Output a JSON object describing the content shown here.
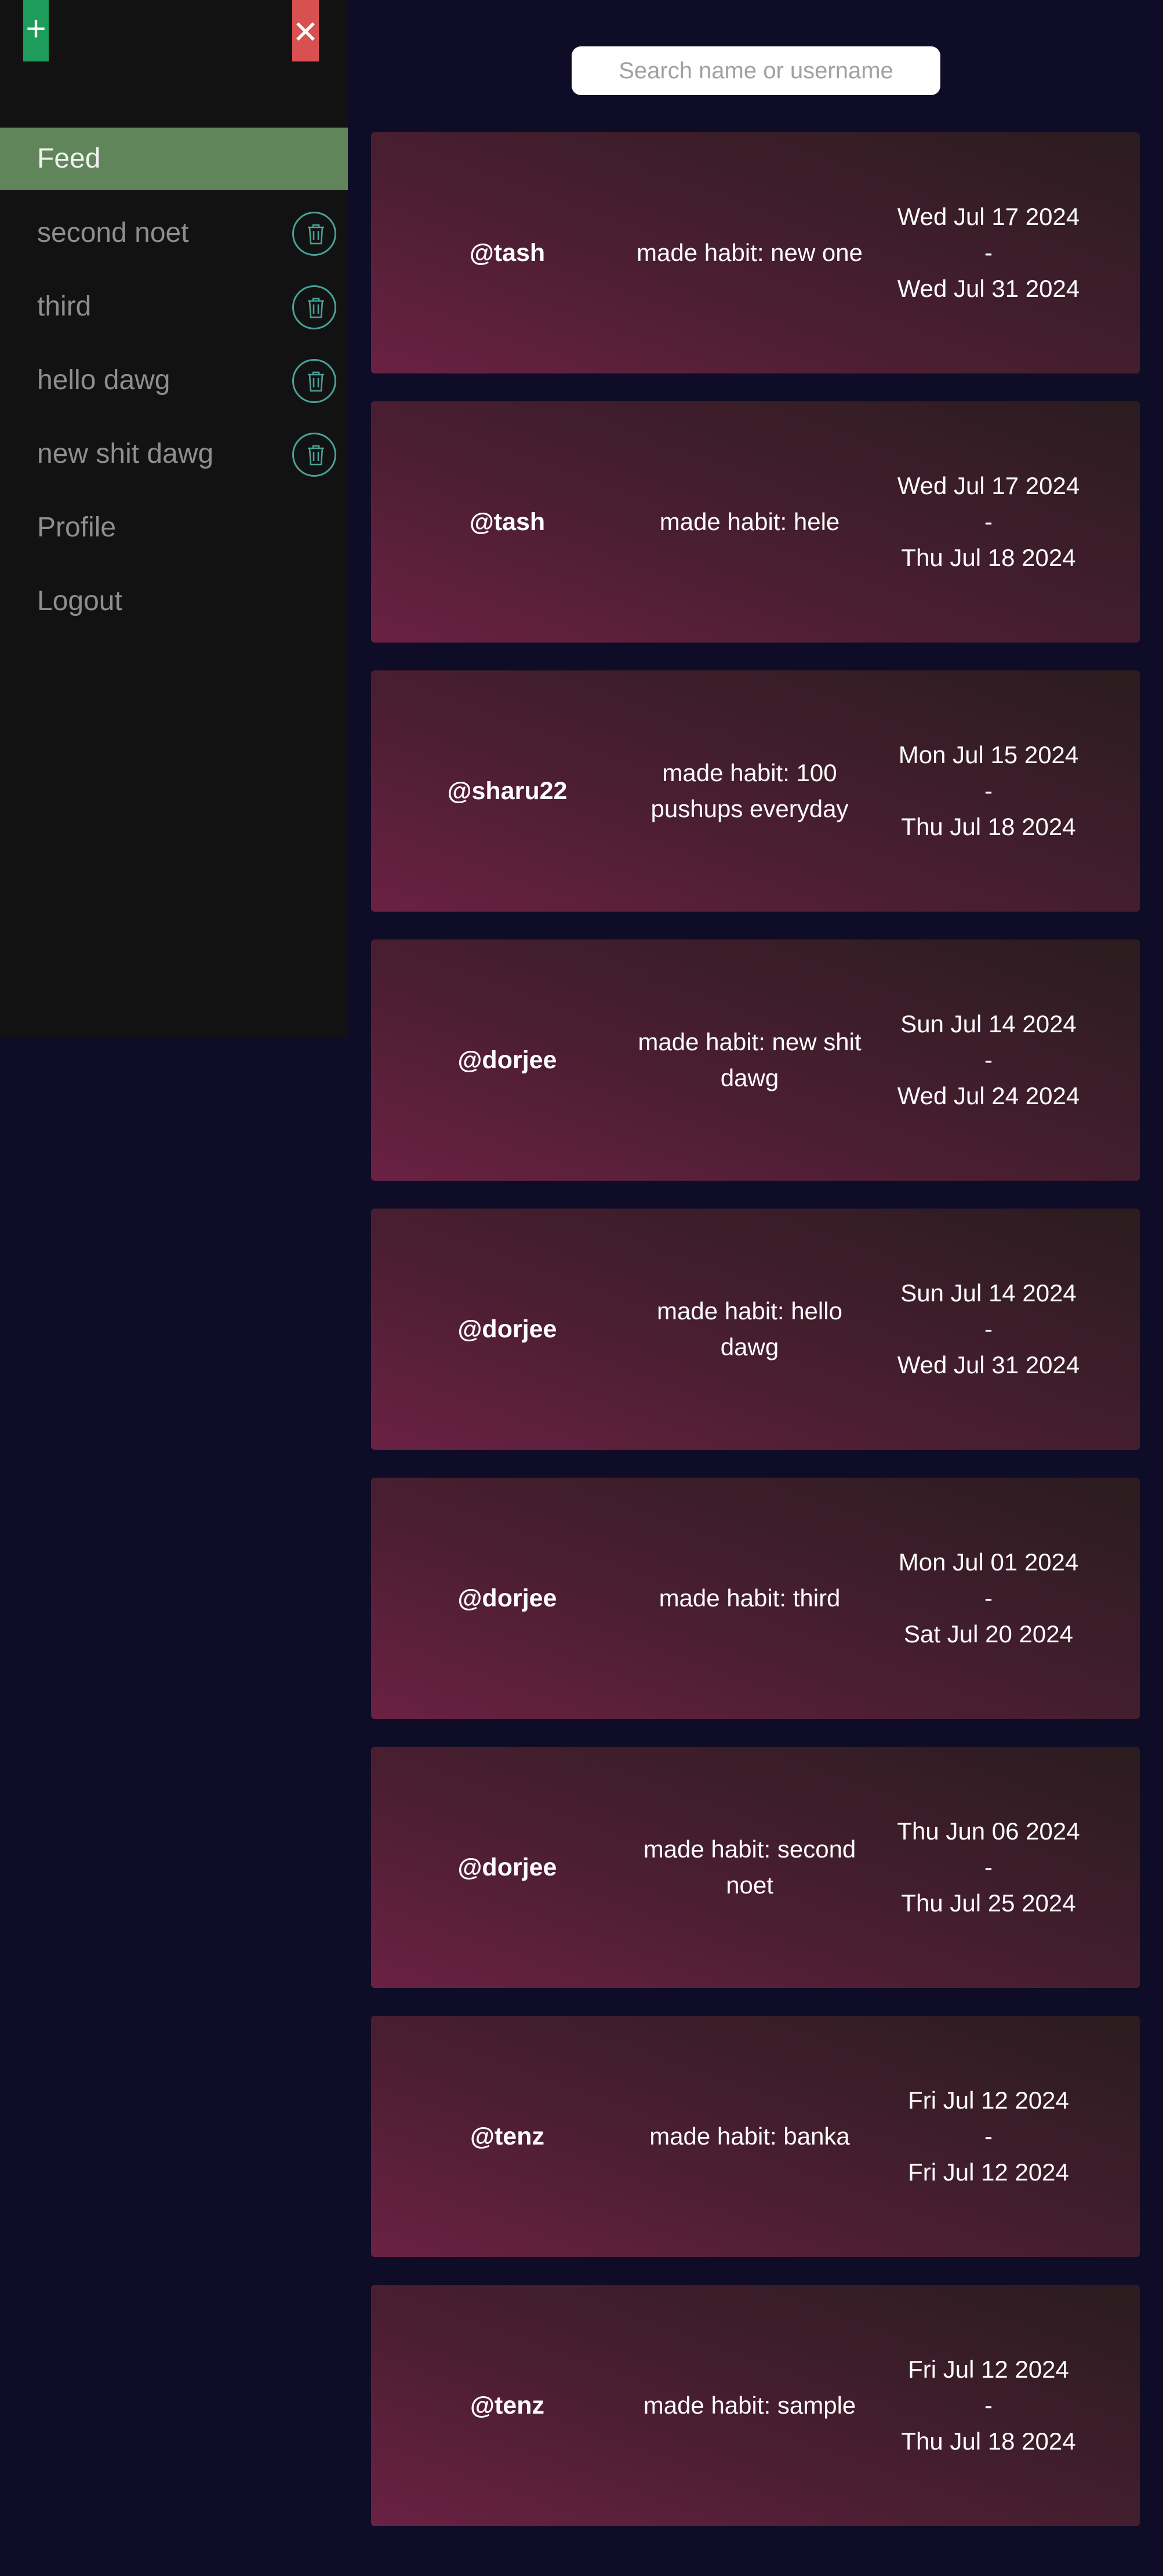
{
  "sidebar": {
    "add_label": "+",
    "close_label": "✕",
    "items": [
      {
        "label": "Feed"
      },
      {
        "label": "second noet"
      },
      {
        "label": "third"
      },
      {
        "label": "hello dawg"
      },
      {
        "label": "new shit dawg"
      },
      {
        "label": "Profile"
      },
      {
        "label": "Logout"
      }
    ]
  },
  "search": {
    "placeholder": "Search name or username",
    "value": ""
  },
  "feed": [
    {
      "user": "@tash",
      "habit": "made habit: new one",
      "start": "Wed Jul 17 2024",
      "sep": "-",
      "end": "Wed Jul 31 2024"
    },
    {
      "user": "@tash",
      "habit": "made habit: hele",
      "start": "Wed Jul 17 2024",
      "sep": "-",
      "end": "Thu Jul 18 2024"
    },
    {
      "user": "@sharu22",
      "habit": "made habit: 100 pushups everyday",
      "start": "Mon Jul 15 2024",
      "sep": "-",
      "end": "Thu Jul 18 2024"
    },
    {
      "user": "@dorjee",
      "habit": "made habit: new shit dawg",
      "start": "Sun Jul 14 2024",
      "sep": "-",
      "end": "Wed Jul 24 2024"
    },
    {
      "user": "@dorjee",
      "habit": "made habit: hello dawg",
      "start": "Sun Jul 14 2024",
      "sep": "-",
      "end": "Wed Jul 31 2024"
    },
    {
      "user": "@dorjee",
      "habit": "made habit: third",
      "start": "Mon Jul 01 2024",
      "sep": "-",
      "end": "Sat Jul 20 2024"
    },
    {
      "user": "@dorjee",
      "habit": "made habit: second noet",
      "start": "Thu Jun 06 2024",
      "sep": "-",
      "end": "Thu Jul 25 2024"
    },
    {
      "user": "@tenz",
      "habit": "made habit: banka",
      "start": "Fri Jul 12 2024",
      "sep": "-",
      "end": "Fri Jul 12 2024"
    },
    {
      "user": "@tenz",
      "habit": "made habit: sample",
      "start": "Fri Jul 12 2024",
      "sep": "-",
      "end": "Thu Jul 18 2024"
    }
  ],
  "colors": {
    "background": "#0f0c27",
    "sidebar": "#121212",
    "active_item": "#60855a",
    "add_button": "#1e9c5a",
    "close_button": "#d95050",
    "trash_ring": "#4aa196"
  }
}
